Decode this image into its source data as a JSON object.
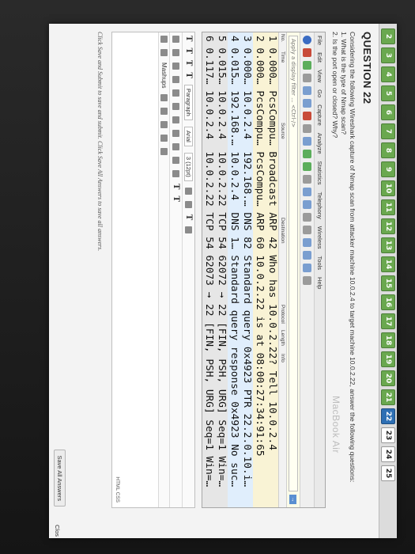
{
  "nav": {
    "numbers": [
      "2",
      "3",
      "4",
      "5",
      "6",
      "7",
      "8",
      "9",
      "10",
      "11",
      "12",
      "13",
      "14",
      "15",
      "16",
      "17",
      "18",
      "19",
      "20",
      "21",
      "22",
      "23",
      "24",
      "25"
    ],
    "done": [
      "2",
      "3",
      "4",
      "5",
      "6",
      "7",
      "8",
      "9",
      "10",
      "11",
      "12",
      "13",
      "14",
      "15",
      "16",
      "17",
      "18",
      "19",
      "20",
      "21"
    ],
    "current": "22"
  },
  "question": {
    "title": "QUESTION 22",
    "intro": "Considering the following Wireshark capture of Nmap scan from attacker machine 10.0.2.4 to target machine 10.0.2.22, answer the following questions:",
    "q1": "1. What is the type of Nmap scan?",
    "q2": "2. Is the port open or closed? Why?"
  },
  "wireshark": {
    "menu": [
      "File",
      "Edit",
      "View",
      "Go",
      "Capture",
      "Analyze",
      "Statistics",
      "Telephony",
      "Wireless",
      "Tools",
      "Help"
    ],
    "filter_placeholder": "Apply a display filter ... <Ctrl-/>",
    "headers": [
      "No.",
      "Time",
      "Source",
      "Destination",
      "Protocol",
      "Length",
      "Info"
    ],
    "rows": [
      "1 0.000… PcsCompu… Broadcast ARP 42 Who has 10.0.2.22? Tell 10.0.2.4",
      "2 0.000… PcsCompu… PcsCompu… ARP 60 10.0.2.22 is at 08:00:27:34:91:65",
      "3 0.000… 10.0.2.4  192.168.… DNS 82 Standard query 0x4923 PTR 22.2.0.10.i…",
      "4 0.015… 192.168.… 10.0.2.4  DNS 1… Standard query response 0x4923 No suc…",
      "5 0.015… 10.0.2.4  10.0.2.22 TCP 54 62072 → 22 [FIN, PSH, URG] Seq=1 Win=…",
      "6 0.117… 10.0.2.4  10.0.2.22 TCP 54 62073 → 22 [FIN, PSH, URG] Seq=1 Win=…"
    ]
  },
  "editor": {
    "paragraph": "Paragraph",
    "font": "Arial",
    "size": "3 (12pt)",
    "mashups": "Mashups",
    "html_badge": "HTML CSS"
  },
  "footer": {
    "note": "Click Save and Submit to save and submit. Click Save All Answers to save all answers.",
    "save_all": "Save All Answers",
    "save_submit": "Clos"
  },
  "bezel_label": "MacBook Air"
}
